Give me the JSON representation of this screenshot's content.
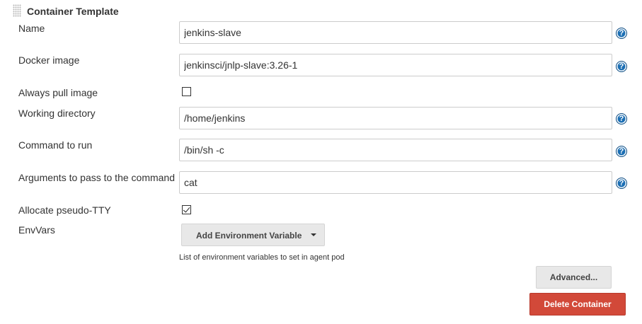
{
  "section": {
    "title": "Container Template",
    "grip_icon": "drag-handle-icon"
  },
  "fields": {
    "name": {
      "label": "Name",
      "value": "jenkins-slave"
    },
    "docker_image": {
      "label": "Docker image",
      "value": "jenkinsci/jnlp-slave:3.26-1"
    },
    "always_pull": {
      "label": "Always pull image",
      "checked": false
    },
    "working_dir": {
      "label": "Working directory",
      "value": "/home/jenkins"
    },
    "command": {
      "label": "Command to run",
      "value": "/bin/sh -c"
    },
    "arguments": {
      "label": "Arguments to pass to the command",
      "value": "cat"
    },
    "tty": {
      "label": "Allocate pseudo-TTY",
      "checked": true
    },
    "envvars": {
      "label": "EnvVars",
      "add_button": "Add Environment Variable",
      "hint": "List of environment variables to set in agent pod"
    }
  },
  "help_icon_glyph": "?",
  "buttons": {
    "advanced": "Advanced...",
    "delete": "Delete Container"
  },
  "colors": {
    "help_icon": "#1c6fb4",
    "delete_button": "#d24939",
    "neutral_button": "#e8e8e8"
  }
}
